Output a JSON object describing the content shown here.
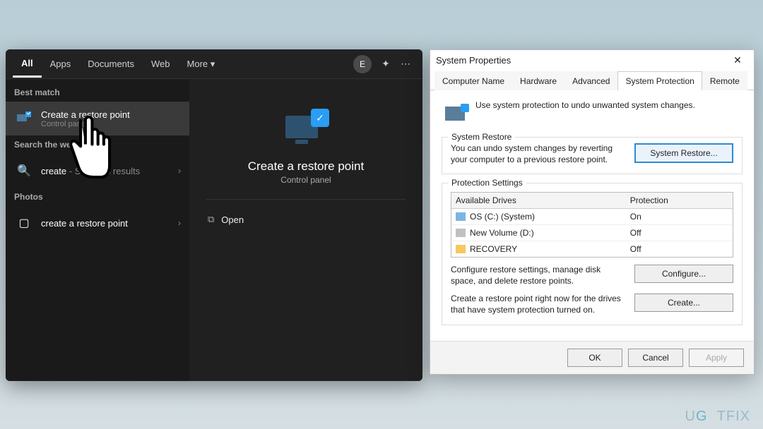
{
  "search": {
    "tabs": [
      "All",
      "Apps",
      "Documents",
      "Web",
      "More ▾"
    ],
    "active_tab": "All",
    "avatar_initial": "E",
    "best_match_label": "Best match",
    "best_match": {
      "title": "Create a restore point",
      "sub": "Control panel"
    },
    "search_web_label": "Search the web",
    "web_result": {
      "title": "create",
      "hint": "- See web results"
    },
    "photos_label": "Photos",
    "photo_result": "create a restore point",
    "preview": {
      "title": "Create a restore point",
      "sub": "Control panel",
      "open_label": "Open"
    }
  },
  "sysprops": {
    "window_title": "System Properties",
    "tabs": [
      "Computer Name",
      "Hardware",
      "Advanced",
      "System Protection",
      "Remote"
    ],
    "active_tab": "System Protection",
    "intro_text": "Use system protection to undo unwanted system changes.",
    "restore_group": "System Restore",
    "restore_desc": "You can undo system changes by reverting your computer to a previous restore point.",
    "restore_button": "System Restore...",
    "protect_group": "Protection Settings",
    "drives_hdr": [
      "Available Drives",
      "Protection"
    ],
    "drives": [
      {
        "icon": "disk",
        "name": "OS (C:) (System)",
        "status": "On"
      },
      {
        "icon": "vol",
        "name": "New Volume (D:)",
        "status": "Off"
      },
      {
        "icon": "folder",
        "name": "RECOVERY",
        "status": "Off"
      }
    ],
    "configure_desc": "Configure restore settings, manage disk space, and delete restore points.",
    "configure_button": "Configure...",
    "create_desc": "Create a restore point right now for the drives that have system protection turned on.",
    "create_button": "Create...",
    "ok": "OK",
    "cancel": "Cancel",
    "apply": "Apply"
  },
  "watermark": "UG  TFIX"
}
